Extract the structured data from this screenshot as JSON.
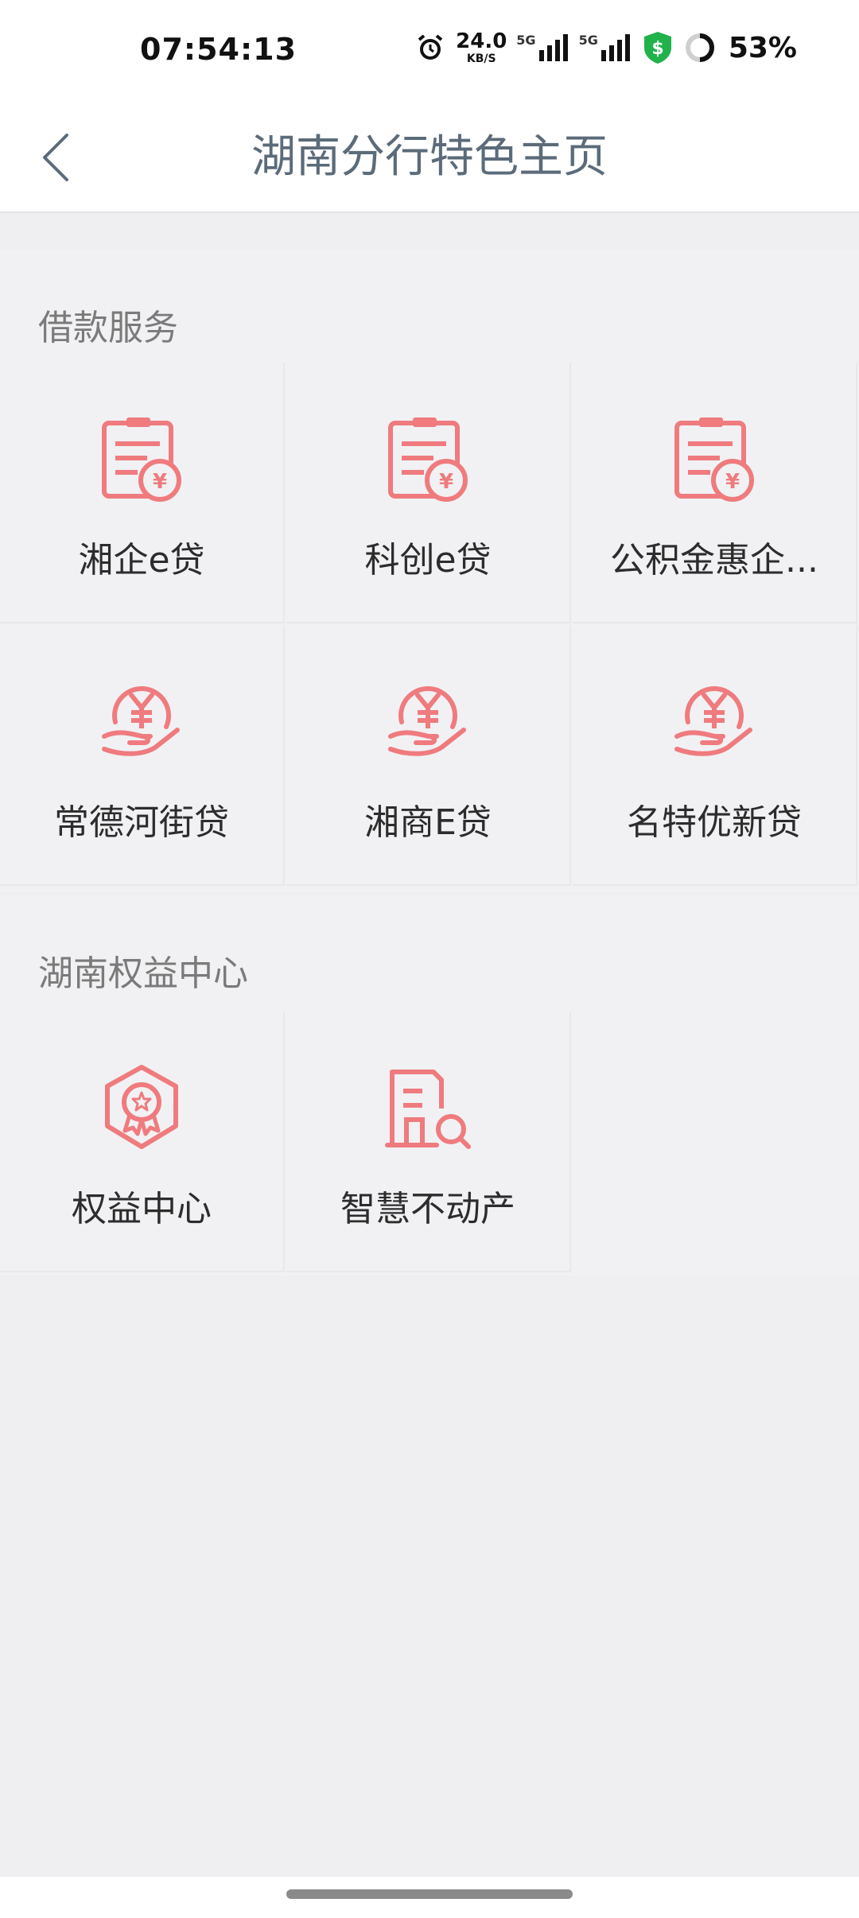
{
  "status_bar": {
    "time": "07:54:13",
    "net_speed": "24.0",
    "net_unit": "KB/S",
    "signal1_label": "5G",
    "signal2_label": "5G",
    "battery": "53%",
    "icons": [
      "alarm-icon",
      "signal-5g-icon",
      "signal-5g-icon",
      "security-shield-icon",
      "battery-ring-icon"
    ]
  },
  "nav": {
    "title": "湖南分行特色主页",
    "back_icon": "chevron-left-icon"
  },
  "colors": {
    "accent": "#ef7b7f",
    "title": "#5b6b7a",
    "background": "#efeff2"
  },
  "sections": [
    {
      "title": "借款服务",
      "items": [
        {
          "label": "湘企e贷",
          "icon": "clipboard-yen-icon"
        },
        {
          "label": "科创e贷",
          "icon": "clipboard-yen-icon"
        },
        {
          "label": "公积金惠企...",
          "icon": "clipboard-yen-icon"
        },
        {
          "label": "常德河街贷",
          "icon": "hand-yen-icon"
        },
        {
          "label": "湘商E贷",
          "icon": "hand-yen-icon"
        },
        {
          "label": "名特优新贷",
          "icon": "hand-yen-icon"
        }
      ]
    },
    {
      "title": "湖南权益中心",
      "items": [
        {
          "label": "权益中心",
          "icon": "badge-icon"
        },
        {
          "label": "智慧不动产",
          "icon": "building-search-icon"
        }
      ]
    }
  ]
}
